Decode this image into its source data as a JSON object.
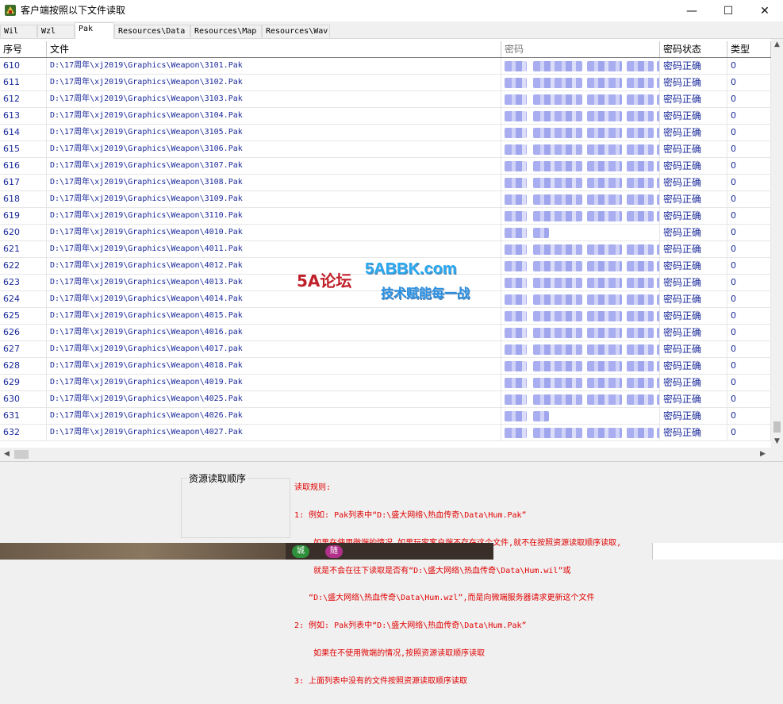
{
  "window": {
    "title": "客户端按照以下文件读取",
    "controls": [
      "—",
      "☐",
      "✕"
    ]
  },
  "tabs": [
    {
      "label": "Wil",
      "active": false
    },
    {
      "label": "Wzl",
      "active": false
    },
    {
      "label": "Pak",
      "active": true
    },
    {
      "label": "Resources\\Data",
      "active": false
    },
    {
      "label": "Resources\\Map",
      "active": false
    },
    {
      "label": "Resources\\Wav",
      "active": false
    }
  ],
  "table": {
    "headers": {
      "index": "序号",
      "file": "文件",
      "password": "密码",
      "status": "密码状态",
      "type": "类型"
    },
    "rows": [
      {
        "index": "610",
        "file": "D:\\17周年\\xj2019\\Graphics\\Weapon\\3101.Pak",
        "status": "密码正确",
        "type": "0"
      },
      {
        "index": "611",
        "file": "D:\\17周年\\xj2019\\Graphics\\Weapon\\3102.Pak",
        "status": "密码正确",
        "type": "0"
      },
      {
        "index": "612",
        "file": "D:\\17周年\\xj2019\\Graphics\\Weapon\\3103.Pak",
        "status": "密码正确",
        "type": "0"
      },
      {
        "index": "613",
        "file": "D:\\17周年\\xj2019\\Graphics\\Weapon\\3104.Pak",
        "status": "密码正确",
        "type": "0"
      },
      {
        "index": "614",
        "file": "D:\\17周年\\xj2019\\Graphics\\Weapon\\3105.Pak",
        "status": "密码正确",
        "type": "0"
      },
      {
        "index": "615",
        "file": "D:\\17周年\\xj2019\\Graphics\\Weapon\\3106.Pak",
        "status": "密码正确",
        "type": "0"
      },
      {
        "index": "616",
        "file": "D:\\17周年\\xj2019\\Graphics\\Weapon\\3107.Pak",
        "status": "密码正确",
        "type": "0"
      },
      {
        "index": "617",
        "file": "D:\\17周年\\xj2019\\Graphics\\Weapon\\3108.Pak",
        "status": "密码正确",
        "type": "0"
      },
      {
        "index": "618",
        "file": "D:\\17周年\\xj2019\\Graphics\\Weapon\\3109.Pak",
        "status": "密码正确",
        "type": "0"
      },
      {
        "index": "619",
        "file": "D:\\17周年\\xj2019\\Graphics\\Weapon\\3110.Pak",
        "status": "密码正确",
        "type": "0"
      },
      {
        "index": "620",
        "file": "D:\\17周年\\xj2019\\Graphics\\Weapon\\4010.Pak",
        "status": "密码正确",
        "type": "0"
      },
      {
        "index": "621",
        "file": "D:\\17周年\\xj2019\\Graphics\\Weapon\\4011.Pak",
        "status": "密码正确",
        "type": "0"
      },
      {
        "index": "622",
        "file": "D:\\17周年\\xj2019\\Graphics\\Weapon\\4012.Pak",
        "status": "密码正确",
        "type": "0"
      },
      {
        "index": "623",
        "file": "D:\\17周年\\xj2019\\Graphics\\Weapon\\4013.Pak",
        "status": "密码正确",
        "type": "0"
      },
      {
        "index": "624",
        "file": "D:\\17周年\\xj2019\\Graphics\\Weapon\\4014.Pak",
        "status": "密码正确",
        "type": "0"
      },
      {
        "index": "625",
        "file": "D:\\17周年\\xj2019\\Graphics\\Weapon\\4015.Pak",
        "status": "密码正确",
        "type": "0"
      },
      {
        "index": "626",
        "file": "D:\\17周年\\xj2019\\Graphics\\Weapon\\4016.pak",
        "status": "密码正确",
        "type": "0"
      },
      {
        "index": "627",
        "file": "D:\\17周年\\xj2019\\Graphics\\Weapon\\4017.pak",
        "status": "密码正确",
        "type": "0"
      },
      {
        "index": "628",
        "file": "D:\\17周年\\xj2019\\Graphics\\Weapon\\4018.Pak",
        "status": "密码正确",
        "type": "0"
      },
      {
        "index": "629",
        "file": "D:\\17周年\\xj2019\\Graphics\\Weapon\\4019.Pak",
        "status": "密码正确",
        "type": "0"
      },
      {
        "index": "630",
        "file": "D:\\17周年\\xj2019\\Graphics\\Weapon\\4025.Pak",
        "status": "密码正确",
        "type": "0"
      },
      {
        "index": "631",
        "file": "D:\\17周年\\xj2019\\Graphics\\Weapon\\4026.Pak",
        "status": "密码正确",
        "type": "0"
      },
      {
        "index": "632",
        "file": "D:\\17周年\\xj2019\\Graphics\\Weapon\\4027.Pak",
        "status": "密码正确",
        "type": "0"
      }
    ]
  },
  "bottom": {
    "group_label": "资源读取顺序",
    "rules": [
      "读取规则:",
      "1: 例如: Pak列表中“D:\\盛大网络\\热血传奇\\Data\\Hum.Pak”",
      "    如果在使用微端的情况,如果玩家客户端不存在这个文件,就不在按照资源读取顺序读取,",
      "    就是不会在往下读取是否有“D:\\盛大网络\\热血传奇\\Data\\Hum.wil”或",
      "   “D:\\盛大网络\\热血传奇\\Data\\Hum.wzl”,而是向微端服务器请求更新这个文件",
      "2: 例如: Pak列表中“D:\\盛大网络\\热血传奇\\Data\\Hum.Pak”",
      "    如果在不使用微端的情况,按照资源读取顺序读取",
      "3: 上面列表中没有的文件按照资源读取顺序读取"
    ]
  },
  "watermark": {
    "logo": "5A论坛",
    "site": "5ABBK.com",
    "slogan": "技术赋能每一战"
  },
  "taskbar_items": [
    "城",
    "随"
  ],
  "colors": {
    "row_text": "#1a2a9a",
    "rules_text": "#e00000",
    "blurred_password": "#9aa0ee",
    "watermark_site": "#27a8f0"
  }
}
